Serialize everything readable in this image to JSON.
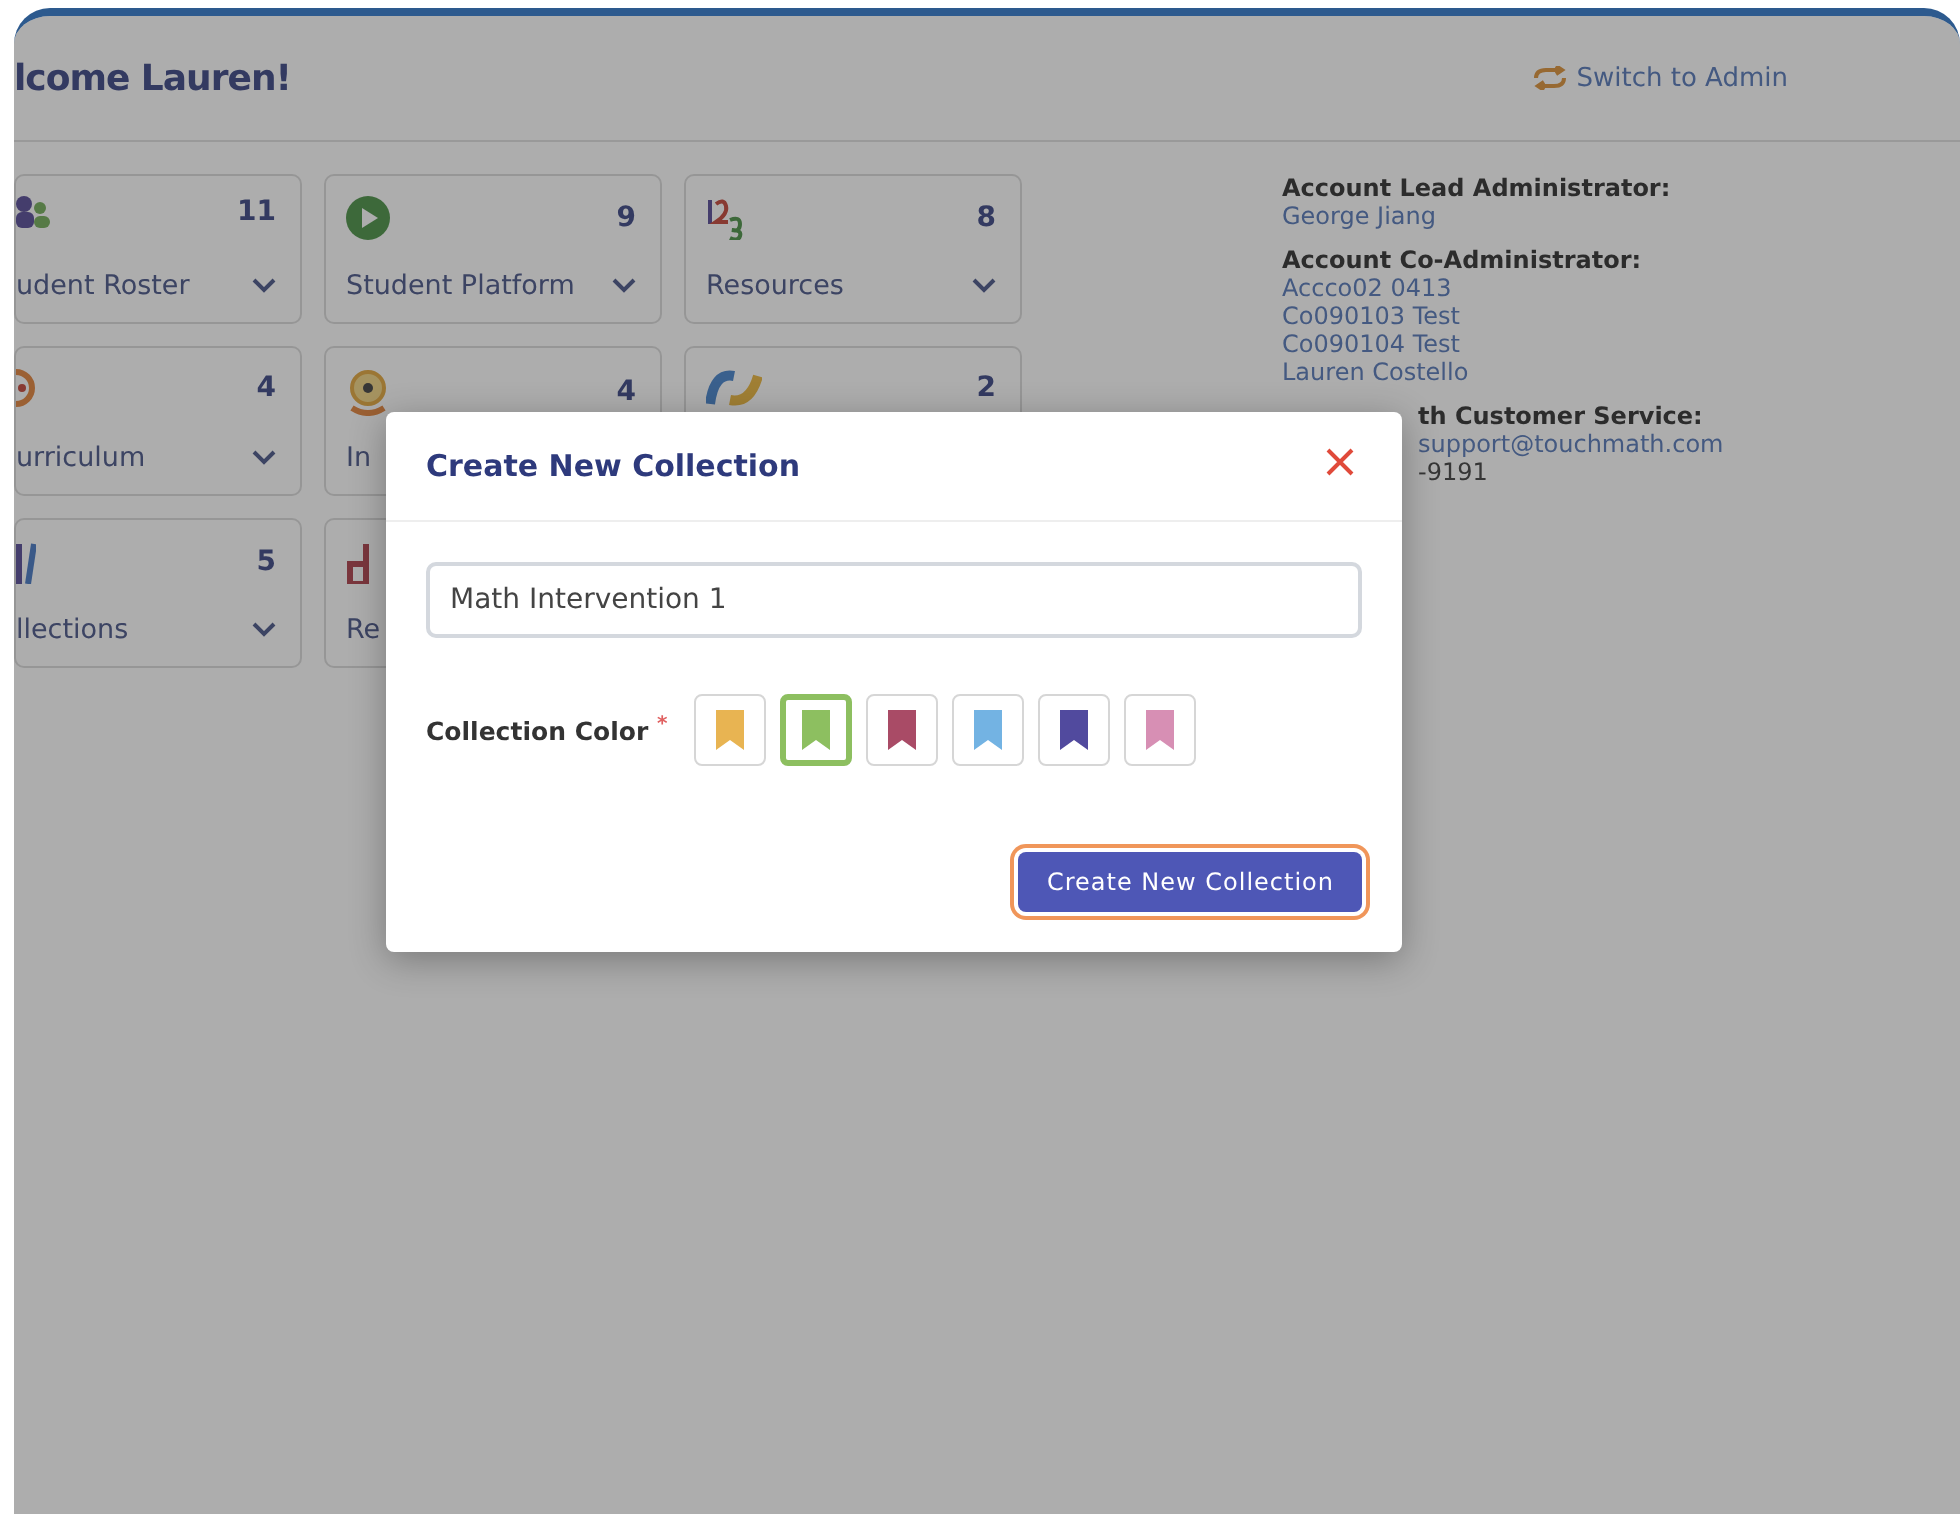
{
  "header": {
    "greeting": "lcome Lauren!",
    "switch_link": "Switch to Admin"
  },
  "tiles": [
    {
      "kind": "people",
      "label": "udent Roster",
      "count": "11"
    },
    {
      "kind": "play",
      "label": "Student Platform",
      "count": "9"
    },
    {
      "kind": "numbers",
      "label": "Resources",
      "count": "8"
    },
    {
      "kind": "target",
      "label": "urriculum",
      "count": "4"
    },
    {
      "kind": "medal",
      "label": "In",
      "count": "4"
    },
    {
      "kind": "wave",
      "count": "2"
    },
    {
      "kind": "books",
      "label": "llections",
      "count": "5"
    },
    {
      "kind": "chart",
      "label": "Re"
    }
  ],
  "contacts": [
    {
      "heading": "Account Lead Administrator:",
      "lines": [
        "George Jiang"
      ]
    },
    {
      "heading": "Account Co-Administrator:",
      "lines": [
        "Accco02 0413",
        "Co090103 Test",
        "Co090104 Test",
        "Lauren Costello"
      ]
    },
    {
      "heading": "th Customer Service:",
      "lines": [
        "support@touchmath.com"
      ],
      "phone": "-9191"
    }
  ],
  "modal": {
    "title": "Create New Collection",
    "name_value": "Math Intervention 1",
    "color_label": "Collection Color",
    "required_mark": "*",
    "colors": [
      {
        "color": "#e8b452",
        "selected": false
      },
      {
        "color": "#8dbf60",
        "selected": true
      },
      {
        "color": "#a94b66",
        "selected": false
      },
      {
        "color": "#73b3e3",
        "selected": false
      },
      {
        "color": "#514a9e",
        "selected": false
      },
      {
        "color": "#d78fb4",
        "selected": false
      }
    ],
    "submit": "Create New Collection"
  }
}
